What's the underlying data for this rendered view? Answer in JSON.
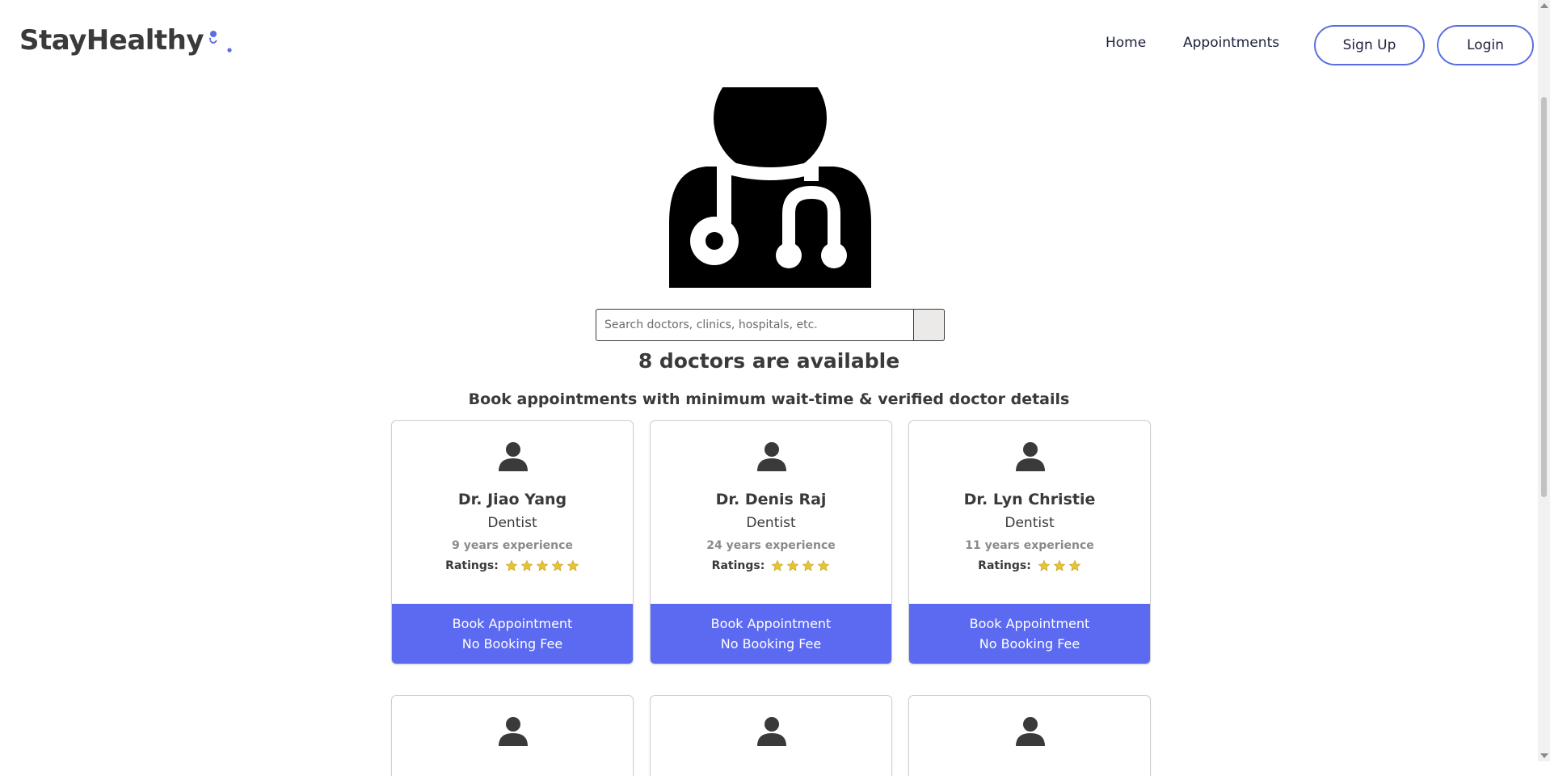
{
  "brand": {
    "name": "StayHealthy",
    "accent": "#5b6ee1"
  },
  "nav": {
    "links": [
      "Home",
      "Appointments"
    ],
    "signup_label": "Sign Up",
    "login_label": "Login"
  },
  "hero": {
    "icon": "doctor-stethoscope-icon"
  },
  "search": {
    "placeholder": "Search doctors, clinics, hospitals, etc."
  },
  "availability": {
    "heading": "8 doctors are available",
    "subheading": "Book appointments with minimum wait-time & verified doctor details"
  },
  "ratings_label": "Ratings:",
  "doctors": [
    {
      "name": "Dr. Jiao Yang",
      "specialty": "Dentist",
      "experience": "9 years experience",
      "stars": 5,
      "book_line1": "Book Appointment",
      "book_line2": "No Booking Fee"
    },
    {
      "name": "Dr. Denis Raj",
      "specialty": "Dentist",
      "experience": "24 years experience",
      "stars": 4,
      "book_line1": "Book Appointment",
      "book_line2": "No Booking Fee"
    },
    {
      "name": "Dr. Lyn Christie",
      "specialty": "Dentist",
      "experience": "11 years experience",
      "stars": 3,
      "book_line1": "Book Appointment",
      "book_line2": "No Booking Fee"
    }
  ],
  "colors": {
    "button": "#5b6af0",
    "star": "#e6c335",
    "text": "#3a3a3a"
  }
}
